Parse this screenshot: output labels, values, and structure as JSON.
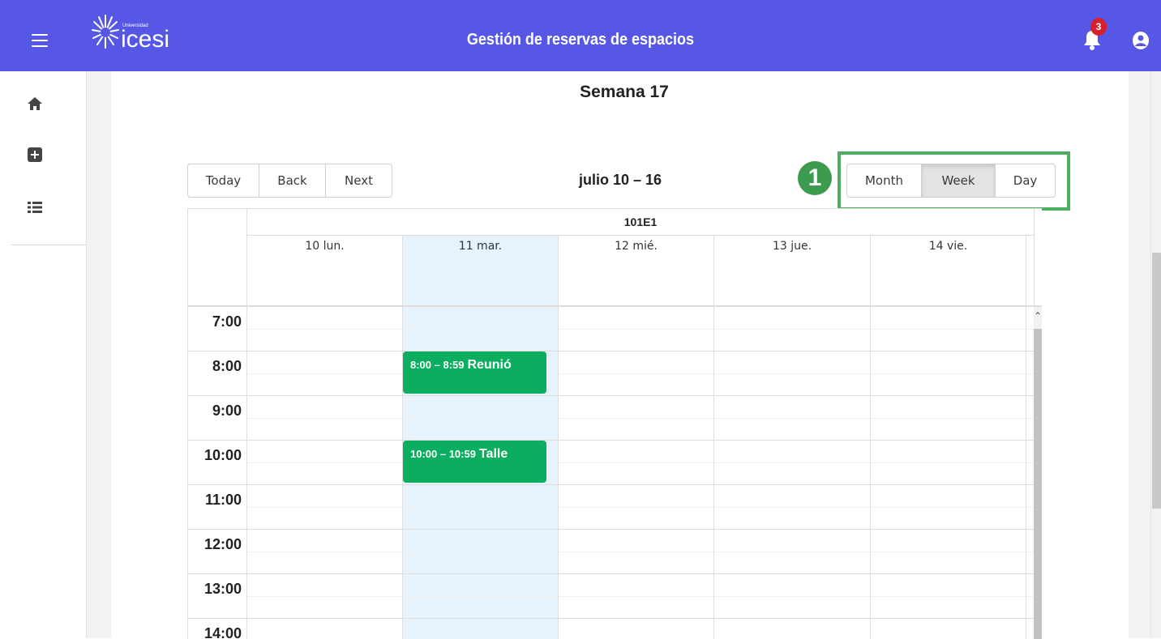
{
  "header": {
    "logo_small": "Universidad",
    "logo_brand": "icesi",
    "title": "Gestión de reservas de espacios",
    "notification_count": "3"
  },
  "sidebar": {
    "items": [
      {
        "icon": "home-icon"
      },
      {
        "icon": "add-square-icon"
      },
      {
        "icon": "list-icon"
      }
    ]
  },
  "main": {
    "week_title": "Semana 17",
    "range_label": "julio 10 – 16",
    "nav_buttons": [
      "Today",
      "Back",
      "Next"
    ],
    "view_buttons": [
      "Month",
      "Week",
      "Day"
    ],
    "active_view": "Week",
    "annotation_marker": "1"
  },
  "calendar": {
    "resource": "101E1",
    "days": [
      "10 lun.",
      "11 mar.",
      "12 mié.",
      "13 jue.",
      "14 vie."
    ],
    "today_index": 1,
    "times": [
      "7:00",
      "8:00",
      "9:00",
      "10:00",
      "11:00",
      "12:00",
      "13:00",
      "14:00"
    ],
    "events": [
      {
        "time": "8:00 – 8:59",
        "title": "Reunió"
      },
      {
        "time": "10:00 – 10:59",
        "title": "Talle"
      }
    ]
  },
  "colors": {
    "topbar": "#5757e6",
    "event": "#0aae5e",
    "today": "#e6f3fc",
    "highlight": "#4caf60"
  }
}
